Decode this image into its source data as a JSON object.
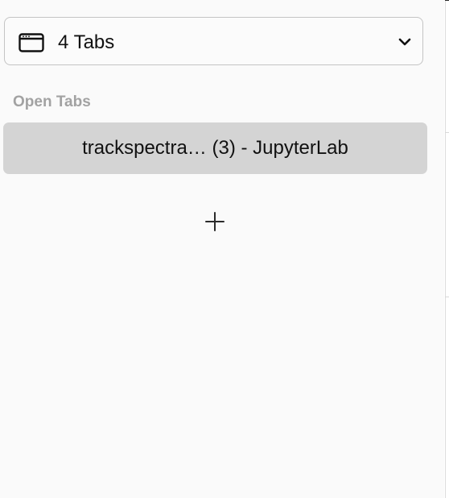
{
  "tab_selector": {
    "label": "4 Tabs",
    "icon": "browser-window-icon",
    "chevron": "chevron-down-icon"
  },
  "open_tabs": {
    "header": "Open Tabs",
    "items": [
      {
        "label": "trackspectra… (3) - JupyterLab"
      }
    ]
  },
  "add_button": {
    "icon": "plus-icon"
  },
  "colors": {
    "background": "#fafafa",
    "selected_row": "#d4d4d4",
    "section_header": "#a2a2a2",
    "border": "#c4c4c4"
  }
}
